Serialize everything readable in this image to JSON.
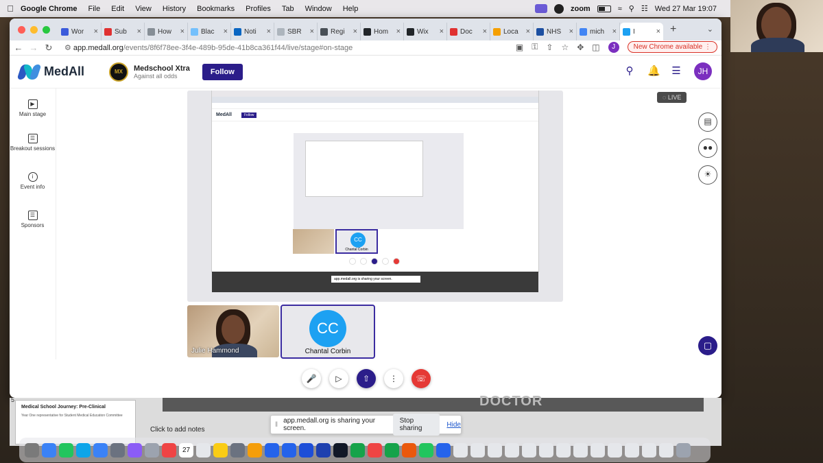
{
  "menubar": {
    "app": "Google Chrome",
    "menus": [
      "File",
      "Edit",
      "View",
      "History",
      "Bookmarks",
      "Profiles",
      "Tab",
      "Window",
      "Help"
    ],
    "zoom_label": "zoom",
    "clock": "Wed 27 Mar  19:07"
  },
  "browser": {
    "tabs": [
      {
        "label": "Wor",
        "color": "#3b5bdb"
      },
      {
        "label": "Sub",
        "color": "#e03131"
      },
      {
        "label": "How",
        "color": "#868e96"
      },
      {
        "label": "Blac",
        "color": "#74c0fc"
      },
      {
        "label": "Noti",
        "color": "#0a66c2"
      },
      {
        "label": "SBR",
        "color": "#adb5bd"
      },
      {
        "label": "Regi",
        "color": "#495057"
      },
      {
        "label": "Hom",
        "color": "#212529"
      },
      {
        "label": "Wix",
        "color": "#212529"
      },
      {
        "label": "Doc",
        "color": "#e03131"
      },
      {
        "label": "Loca",
        "color": "#f59f00"
      },
      {
        "label": "NHS",
        "color": "#1c4fa1"
      },
      {
        "label": "mich",
        "color": "#4285f4"
      },
      {
        "label": "I",
        "color": "#1da1f2"
      }
    ],
    "url_main": "app.medall.org",
    "url_path": "/events/8f6f78ee-3f4e-489b-95de-41b8ca361f44/live/stage#on-stage",
    "profile_initial": "J",
    "update_label": "New Chrome available"
  },
  "header": {
    "logo_text": "MedAll",
    "org_name": "Medschool Xtra",
    "org_tagline": "Against all odds",
    "org_badge": "MX",
    "follow_label": "Follow",
    "user_initials": "JH"
  },
  "sidebar": {
    "items": [
      {
        "label": "Main stage",
        "icon": "monitor-icon"
      },
      {
        "label": "Breakout sessions",
        "icon": "breakout-icon"
      },
      {
        "label": "Event info",
        "icon": "info-icon"
      },
      {
        "label": "Sponsors",
        "icon": "sponsors-icon"
      }
    ]
  },
  "stage": {
    "live_label": "LIVE",
    "nested_logo": "MedAll",
    "nested_follow": "Follow",
    "nested_cc_initials": "CC",
    "nested_cc_name": "Chantal Corbin",
    "nested_share_text": "app.medall.org is sharing your screen."
  },
  "participants": [
    {
      "name": "Julie Hammond",
      "type": "video"
    },
    {
      "name": "Chantal Corbin",
      "initials": "CC",
      "type": "avatar",
      "color": "#1da1f2"
    }
  ],
  "keynote": {
    "slide_number": "5",
    "slide_title": "Medical School Journey: Pre-Clinical",
    "slide_sub": "Year One representative for Student Medical Education Committee",
    "add_notes": "Click to add notes",
    "slide_word": "DOCTOR"
  },
  "sharebar": {
    "message": "app.medall.org is sharing your screen.",
    "stop_label": "Stop sharing",
    "hide_label": "Hide"
  },
  "dock": {
    "calendar_day": "27",
    "colors": [
      "#7a7a7a",
      "#3b82f6",
      "#22c55e",
      "#0ea5e9",
      "#3b82f6",
      "#6b7280",
      "#8b5cf6",
      "#9ca3af",
      "#ef4444",
      "#b45309",
      "#e5e7eb",
      "#facc15",
      "#6b7280",
      "#f59e0b",
      "#2563eb",
      "#2563eb",
      "#1d4ed8",
      "#1e40af",
      "#111827",
      "#16a34a",
      "#ef4444",
      "#16a34a",
      "#ea580c",
      "#22c55e",
      "#2563eb",
      "#e5e7eb",
      "#e5e7eb",
      "#e5e7eb",
      "#e5e7eb",
      "#e5e7eb",
      "#e5e7eb",
      "#e5e7eb",
      "#e5e7eb",
      "#e5e7eb",
      "#e5e7eb",
      "#e5e7eb",
      "#e5e7eb",
      "#e5e7eb",
      "#9ca3af"
    ]
  }
}
